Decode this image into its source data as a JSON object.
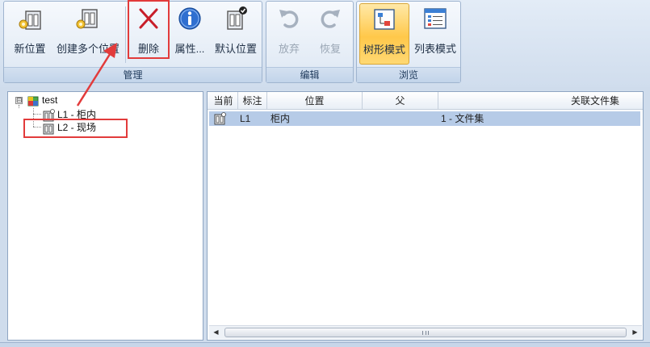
{
  "ribbon": {
    "groups": [
      {
        "label": "管理",
        "buttons": [
          {
            "label": "新位置",
            "icon": "new-location-icon"
          },
          {
            "label": "创建多个位置",
            "icon": "create-multiple-locations-icon"
          },
          {
            "label": "删除",
            "icon": "delete-x-icon"
          },
          {
            "label": "属性...",
            "icon": "info-icon"
          },
          {
            "label": "默认位置",
            "icon": "default-location-icon"
          }
        ]
      },
      {
        "label": "编辑",
        "buttons": [
          {
            "label": "放弃",
            "icon": "undo-icon",
            "state": "disabled"
          },
          {
            "label": "恢复",
            "icon": "redo-icon",
            "state": "disabled"
          }
        ]
      },
      {
        "label": "浏览",
        "buttons": [
          {
            "label": "树形模式",
            "icon": "tree-mode-icon",
            "state": "active"
          },
          {
            "label": "列表模式",
            "icon": "list-mode-icon"
          }
        ]
      }
    ]
  },
  "tree": {
    "root": {
      "label": "test",
      "icon": "cabinet-icon",
      "expander": "⊟"
    },
    "children": [
      {
        "label": "L1 - 柜内",
        "icon": "location-icon"
      },
      {
        "label": "L2 - 现场",
        "icon": "location-icon"
      }
    ]
  },
  "table": {
    "columns": [
      "当前",
      "标注",
      "位置",
      "父",
      "关联文件集"
    ],
    "rows": [
      {
        "current_icon": "location-icon",
        "tag": "L1",
        "location": "柜内",
        "parent": "",
        "fileset": "1 - 文件集"
      }
    ]
  },
  "scrollbar": {
    "left_arrow": "◀",
    "right_arrow": "▶"
  },
  "colors": {
    "annotation": "#e23b3b",
    "selected_row": "#b6cbe7",
    "active_button": "#ffc84a",
    "ribbon_border": "#9fb4cf"
  }
}
